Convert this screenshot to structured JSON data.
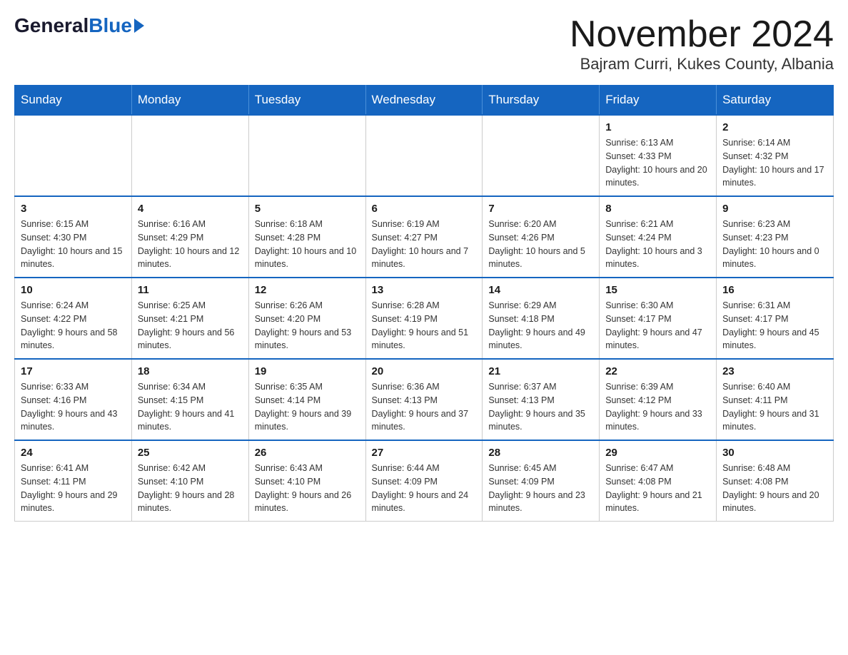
{
  "header": {
    "logo": {
      "general": "General",
      "blue": "Blue"
    },
    "title": "November 2024",
    "subtitle": "Bajram Curri, Kukes County, Albania"
  },
  "calendar": {
    "days_of_week": [
      "Sunday",
      "Monday",
      "Tuesday",
      "Wednesday",
      "Thursday",
      "Friday",
      "Saturday"
    ],
    "weeks": [
      {
        "days": [
          {
            "number": "",
            "info": ""
          },
          {
            "number": "",
            "info": ""
          },
          {
            "number": "",
            "info": ""
          },
          {
            "number": "",
            "info": ""
          },
          {
            "number": "",
            "info": ""
          },
          {
            "number": "1",
            "info": "Sunrise: 6:13 AM\nSunset: 4:33 PM\nDaylight: 10 hours and 20 minutes."
          },
          {
            "number": "2",
            "info": "Sunrise: 6:14 AM\nSunset: 4:32 PM\nDaylight: 10 hours and 17 minutes."
          }
        ]
      },
      {
        "days": [
          {
            "number": "3",
            "info": "Sunrise: 6:15 AM\nSunset: 4:30 PM\nDaylight: 10 hours and 15 minutes."
          },
          {
            "number": "4",
            "info": "Sunrise: 6:16 AM\nSunset: 4:29 PM\nDaylight: 10 hours and 12 minutes."
          },
          {
            "number": "5",
            "info": "Sunrise: 6:18 AM\nSunset: 4:28 PM\nDaylight: 10 hours and 10 minutes."
          },
          {
            "number": "6",
            "info": "Sunrise: 6:19 AM\nSunset: 4:27 PM\nDaylight: 10 hours and 7 minutes."
          },
          {
            "number": "7",
            "info": "Sunrise: 6:20 AM\nSunset: 4:26 PM\nDaylight: 10 hours and 5 minutes."
          },
          {
            "number": "8",
            "info": "Sunrise: 6:21 AM\nSunset: 4:24 PM\nDaylight: 10 hours and 3 minutes."
          },
          {
            "number": "9",
            "info": "Sunrise: 6:23 AM\nSunset: 4:23 PM\nDaylight: 10 hours and 0 minutes."
          }
        ]
      },
      {
        "days": [
          {
            "number": "10",
            "info": "Sunrise: 6:24 AM\nSunset: 4:22 PM\nDaylight: 9 hours and 58 minutes."
          },
          {
            "number": "11",
            "info": "Sunrise: 6:25 AM\nSunset: 4:21 PM\nDaylight: 9 hours and 56 minutes."
          },
          {
            "number": "12",
            "info": "Sunrise: 6:26 AM\nSunset: 4:20 PM\nDaylight: 9 hours and 53 minutes."
          },
          {
            "number": "13",
            "info": "Sunrise: 6:28 AM\nSunset: 4:19 PM\nDaylight: 9 hours and 51 minutes."
          },
          {
            "number": "14",
            "info": "Sunrise: 6:29 AM\nSunset: 4:18 PM\nDaylight: 9 hours and 49 minutes."
          },
          {
            "number": "15",
            "info": "Sunrise: 6:30 AM\nSunset: 4:17 PM\nDaylight: 9 hours and 47 minutes."
          },
          {
            "number": "16",
            "info": "Sunrise: 6:31 AM\nSunset: 4:17 PM\nDaylight: 9 hours and 45 minutes."
          }
        ]
      },
      {
        "days": [
          {
            "number": "17",
            "info": "Sunrise: 6:33 AM\nSunset: 4:16 PM\nDaylight: 9 hours and 43 minutes."
          },
          {
            "number": "18",
            "info": "Sunrise: 6:34 AM\nSunset: 4:15 PM\nDaylight: 9 hours and 41 minutes."
          },
          {
            "number": "19",
            "info": "Sunrise: 6:35 AM\nSunset: 4:14 PM\nDaylight: 9 hours and 39 minutes."
          },
          {
            "number": "20",
            "info": "Sunrise: 6:36 AM\nSunset: 4:13 PM\nDaylight: 9 hours and 37 minutes."
          },
          {
            "number": "21",
            "info": "Sunrise: 6:37 AM\nSunset: 4:13 PM\nDaylight: 9 hours and 35 minutes."
          },
          {
            "number": "22",
            "info": "Sunrise: 6:39 AM\nSunset: 4:12 PM\nDaylight: 9 hours and 33 minutes."
          },
          {
            "number": "23",
            "info": "Sunrise: 6:40 AM\nSunset: 4:11 PM\nDaylight: 9 hours and 31 minutes."
          }
        ]
      },
      {
        "days": [
          {
            "number": "24",
            "info": "Sunrise: 6:41 AM\nSunset: 4:11 PM\nDaylight: 9 hours and 29 minutes."
          },
          {
            "number": "25",
            "info": "Sunrise: 6:42 AM\nSunset: 4:10 PM\nDaylight: 9 hours and 28 minutes."
          },
          {
            "number": "26",
            "info": "Sunrise: 6:43 AM\nSunset: 4:10 PM\nDaylight: 9 hours and 26 minutes."
          },
          {
            "number": "27",
            "info": "Sunrise: 6:44 AM\nSunset: 4:09 PM\nDaylight: 9 hours and 24 minutes."
          },
          {
            "number": "28",
            "info": "Sunrise: 6:45 AM\nSunset: 4:09 PM\nDaylight: 9 hours and 23 minutes."
          },
          {
            "number": "29",
            "info": "Sunrise: 6:47 AM\nSunset: 4:08 PM\nDaylight: 9 hours and 21 minutes."
          },
          {
            "number": "30",
            "info": "Sunrise: 6:48 AM\nSunset: 4:08 PM\nDaylight: 9 hours and 20 minutes."
          }
        ]
      }
    ]
  }
}
